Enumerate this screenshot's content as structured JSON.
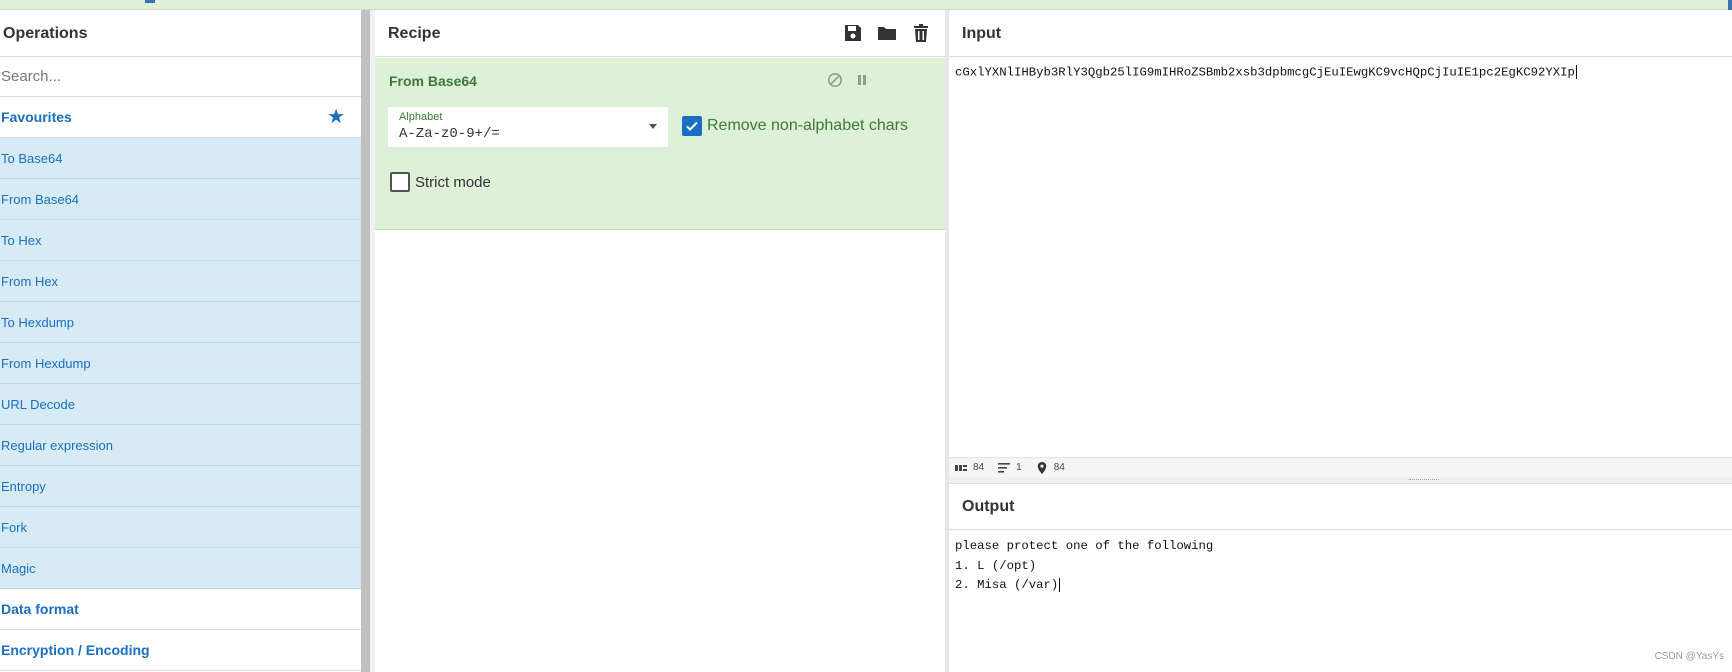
{
  "operations": {
    "title": "Operations",
    "search_placeholder": "Search...",
    "favourites_label": "Favourites",
    "items": [
      {
        "label": "To Base64"
      },
      {
        "label": "From Base64"
      },
      {
        "label": "To Hex"
      },
      {
        "label": "From Hex"
      },
      {
        "label": "To Hexdump"
      },
      {
        "label": "From Hexdump"
      },
      {
        "label": "URL Decode"
      },
      {
        "label": "Regular expression"
      },
      {
        "label": "Entropy"
      },
      {
        "label": "Fork"
      },
      {
        "label": "Magic"
      }
    ],
    "categories": [
      {
        "label": "Data format"
      },
      {
        "label": "Encryption / Encoding"
      }
    ]
  },
  "recipe": {
    "title": "Recipe",
    "icons": [
      "save-icon",
      "folder-icon",
      "trash-icon"
    ],
    "operation": {
      "title": "From Base64",
      "alphabet_label": "Alphabet",
      "alphabet_value": "A-Za-z0-9+/=",
      "remove_nonalpha_label": "Remove non-alphabet chars",
      "remove_nonalpha_checked": true,
      "strict_mode_label": "Strict mode",
      "strict_mode_checked": false
    }
  },
  "input": {
    "title": "Input",
    "text": "cGxlYXNlIHByb3RlY3Qgb25lIG9mIHRoZSBmb2xsb3dpbmcgCjEuIEwgKC9vcHQpCjIuIE1pc2EgKC92YXIp",
    "status": {
      "length": "84",
      "lines": "1",
      "position": "84"
    }
  },
  "output": {
    "title": "Output",
    "lines": [
      "please protect one of the following",
      "1. L (/opt)",
      "2. Misa (/var)"
    ]
  },
  "watermark": "CSDN @YasYs",
  "colors": {
    "accent": "#1b6fc0",
    "op_bg": "#d6ebf5",
    "recipe_bg": "#dff0d8",
    "recipe_text": "#3a7b36"
  }
}
